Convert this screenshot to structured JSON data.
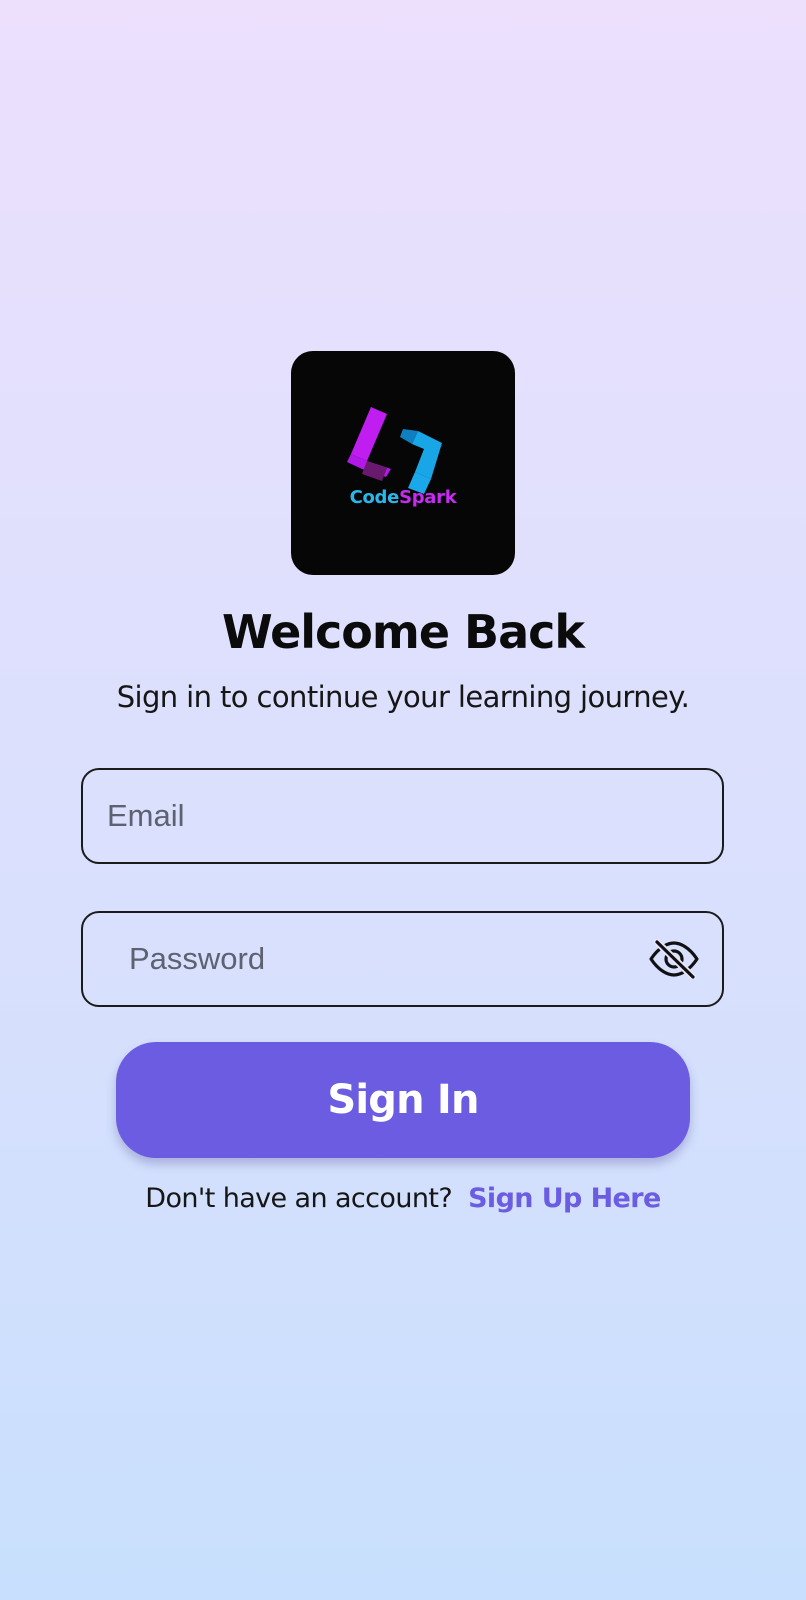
{
  "logo": {
    "word_code": "Code",
    "word_spark": "Spark",
    "colors": {
      "tile": "#060606",
      "code": "#2ab7ec",
      "spark": "#c52bf0"
    }
  },
  "header": {
    "title": "Welcome Back",
    "subtitle": "Sign in to continue your learning journey."
  },
  "form": {
    "email_placeholder": "Email",
    "email_value": "",
    "password_placeholder": "Password",
    "password_value": "",
    "password_toggle_icon": "eye-off-icon",
    "submit_label": "Sign In"
  },
  "footer": {
    "prompt": "Don't have an account?",
    "link_label": "Sign Up Here"
  },
  "colors": {
    "accent": "#6b5ce2",
    "bg_top": "#ece0fd",
    "bg_bottom": "#c8e0fd"
  }
}
